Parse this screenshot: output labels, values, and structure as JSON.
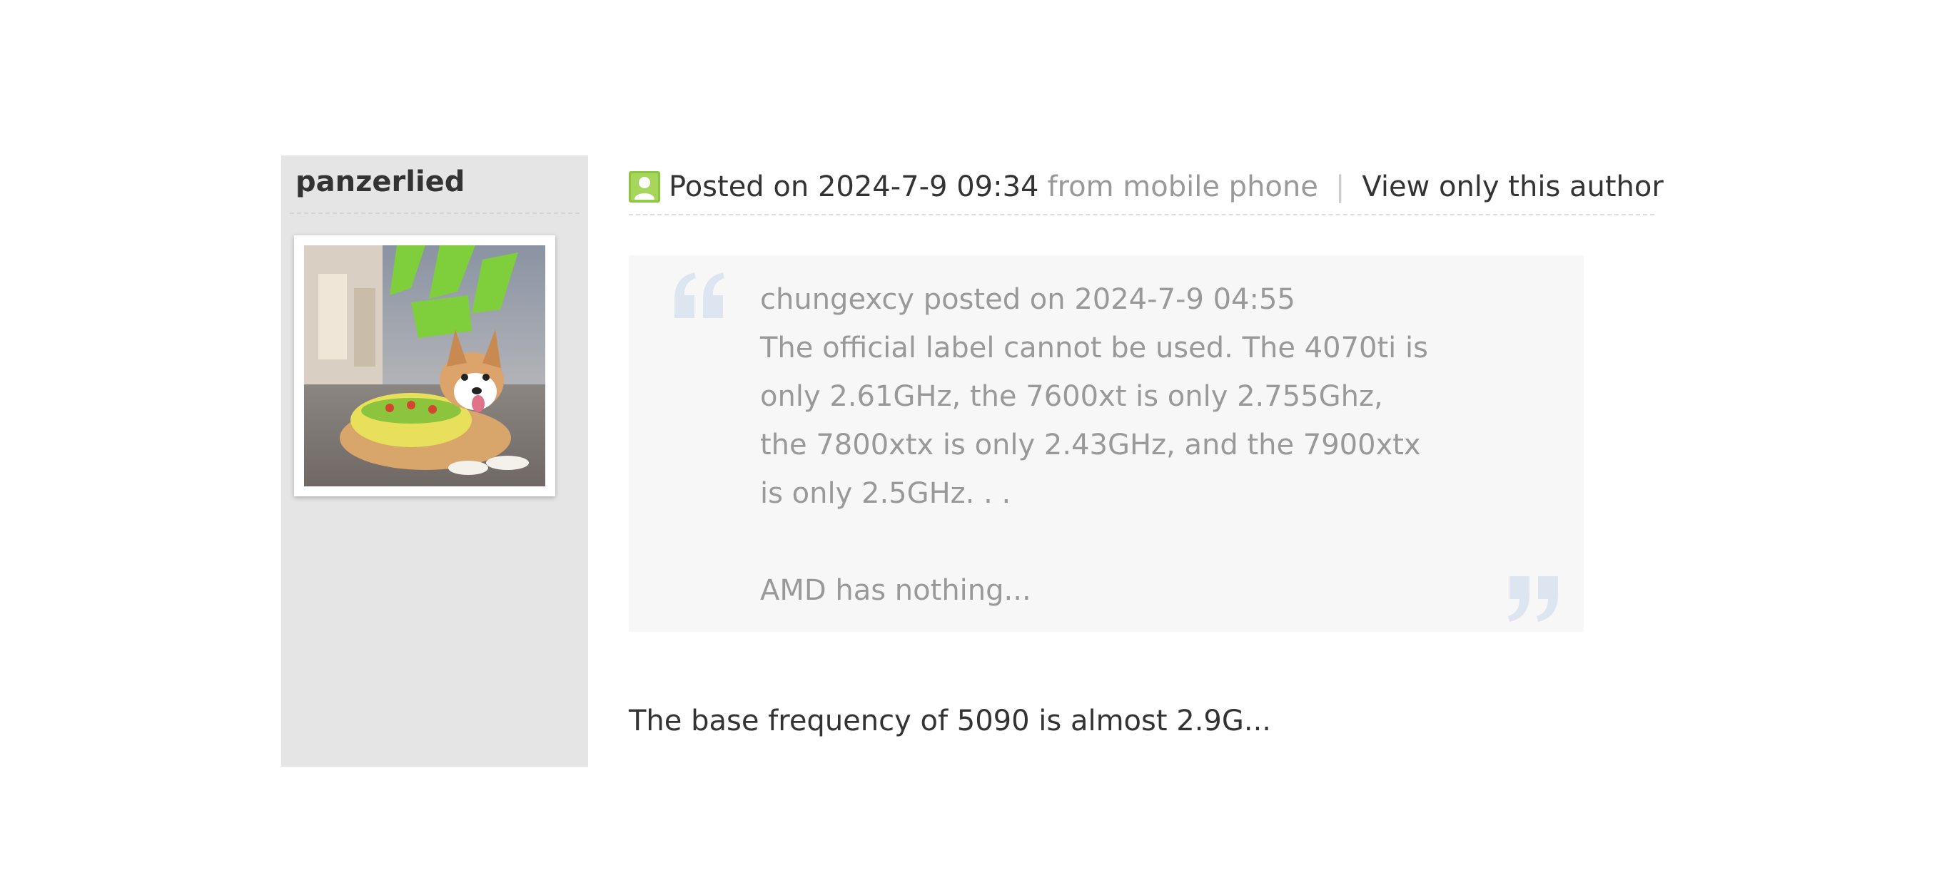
{
  "author": {
    "username": "panzerlied",
    "avatar_icon": "corgi-avatar-image"
  },
  "post_header": {
    "posted_on": "Posted on 2024-7-9 09:34",
    "from": "from mobile phone",
    "separator": "|",
    "view_only_author": "View only this author"
  },
  "quote": {
    "attribution": "chungexcy posted on 2024-7-9 04:55",
    "paragraph_1": "The official label cannot be used. The 4070ti is only 2.61GHz, the 7600xt is only 2.755Ghz, the 7800xtx is only 2.43GHz, and the 7900xtx is only 2.5GHz. . .",
    "paragraph_2": "AMD has nothing..."
  },
  "reply": {
    "text": "The base frequency of 5090 is almost 2.9G..."
  },
  "colors": {
    "sidebar_bg": "#e5e5e5",
    "quote_bg": "#f7f7f7",
    "quote_mark": "#dde6f0",
    "author_icon": "#8cc63f"
  }
}
